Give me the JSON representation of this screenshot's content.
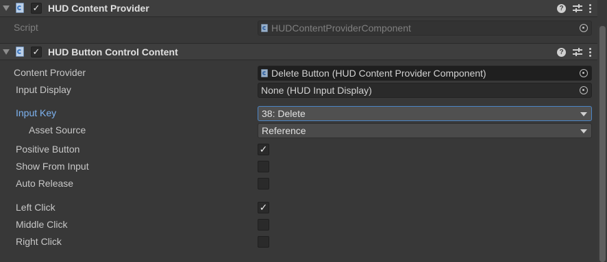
{
  "component1": {
    "title": "HUD Content Provider",
    "enabled_mark": "✓",
    "script_label": "Script",
    "script_value": "HUDContentProviderComponent"
  },
  "component2": {
    "title": "HUD Button Control Content",
    "enabled_mark": "✓",
    "fields": {
      "content_provider": {
        "label": "Content Provider",
        "value": "Delete Button (HUD Content Provider Component)"
      },
      "input_display": {
        "label": "Input Display",
        "value": "None (HUD Input Display)"
      },
      "input_key": {
        "label": "Input Key",
        "value": "38: Delete"
      },
      "asset_source": {
        "label": "Asset Source",
        "value": "Reference"
      },
      "positive_button": {
        "label": "Positive Button",
        "checked": true
      },
      "show_from_input": {
        "label": "Show From Input",
        "checked": false
      },
      "auto_release": {
        "label": "Auto Release",
        "checked": false
      },
      "left_click": {
        "label": "Left Click",
        "checked": true
      },
      "middle_click": {
        "label": "Middle Click",
        "checked": false
      },
      "right_click": {
        "label": "Right Click",
        "checked": false
      }
    }
  },
  "icons": {
    "help": "?",
    "check_glyph": "✓"
  },
  "colors": {
    "background": "#383838",
    "header": "#3e3e3e",
    "highlight_label": "#7eb3f0",
    "focus_border": "#4b86c8"
  }
}
